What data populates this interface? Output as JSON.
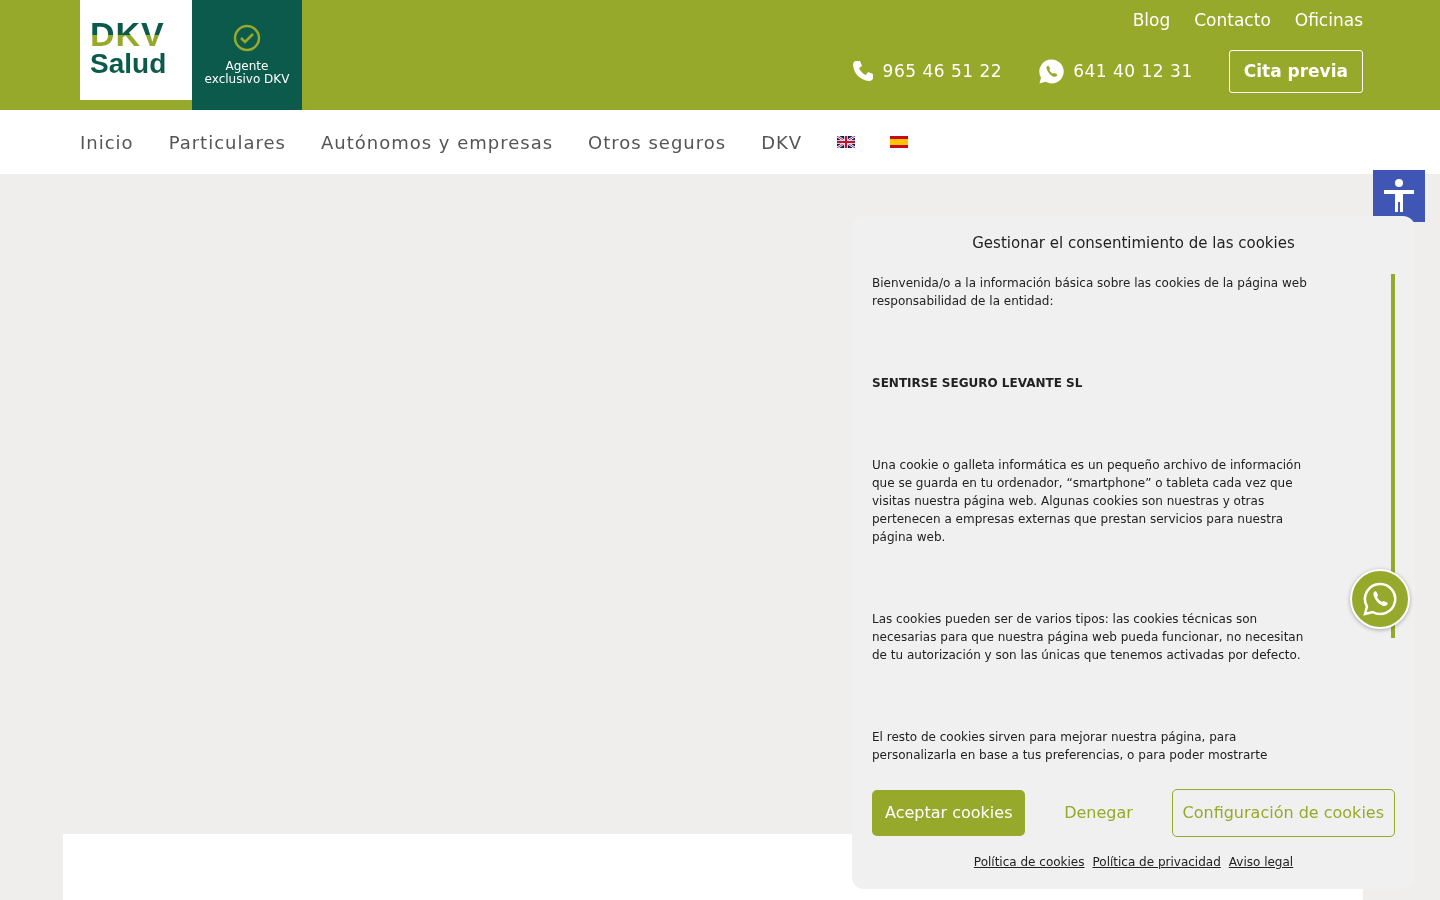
{
  "logo": {
    "brand": "DKV",
    "product": "Salud",
    "badge": "Agente exclusivo DKV"
  },
  "top_links": [
    "Blog",
    "Contacto",
    "Oficinas"
  ],
  "phones": [
    {
      "kind": "phone",
      "number": "965 46 51 22"
    },
    {
      "kind": "whatsapp",
      "number": "641 40 12 31"
    }
  ],
  "appointment_button": "Cita previa",
  "nav": [
    {
      "kind": "text",
      "label": "Inicio"
    },
    {
      "kind": "text",
      "label": "Particulares"
    },
    {
      "kind": "text",
      "label": "Autónomos y empresas"
    },
    {
      "kind": "text",
      "label": "Otros seguros"
    },
    {
      "kind": "text",
      "label": "DKV"
    },
    {
      "kind": "flag-en"
    },
    {
      "kind": "flag-es"
    }
  ],
  "cookie_dialog": {
    "title": "Gestionar el consentimiento de las cookies",
    "paragraphs": [
      {
        "kind": "text",
        "text": "Bienvenida/o a la información básica sobre las cookies de la página web responsabilidad de la entidad:"
      },
      {
        "kind": "bold",
        "text": "SENTIRSE SEGURO LEVANTE SL"
      },
      {
        "kind": "text",
        "text": "Una cookie o galleta informática es un pequeño archivo de información que se guarda en tu ordenador, “smartphone” o tableta cada vez que visitas nuestra página web. Algunas cookies son nuestras y otras pertenecen a empresas externas que prestan servicios para nuestra página web."
      },
      {
        "kind": "text",
        "text": "Las cookies pueden ser de varios tipos: las cookies técnicas son necesarias para que nuestra página web pueda funcionar, no necesitan de tu autorización y son las únicas que tenemos activadas por defecto."
      },
      {
        "kind": "text",
        "text": "El resto de cookies sirven para mejorar nuestra página, para personalizarla en base a tus preferencias, o para poder mostrarte"
      }
    ],
    "buttons": [
      {
        "kind": "filled",
        "label": "Aceptar cookies"
      },
      {
        "kind": "plain",
        "label": "Denegar"
      },
      {
        "kind": "outline",
        "label": "Configuración de cookies"
      }
    ],
    "links": [
      "Política de cookies",
      "Política de privacidad",
      "Aviso legal"
    ]
  }
}
